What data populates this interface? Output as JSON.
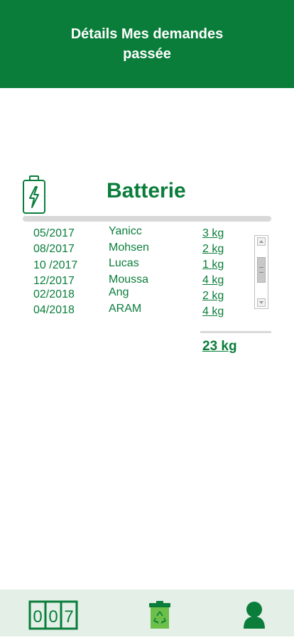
{
  "header": {
    "title": "Détails Mes demandes passée"
  },
  "section": {
    "title": "Batterie",
    "icon": "battery-charging-icon"
  },
  "rows": [
    {
      "date": "05/2017",
      "name": "Yanicc",
      "weight": "3 kg"
    },
    {
      "date": "08/2017",
      "name": "Mohsen",
      "weight": "2 kg"
    },
    {
      "date": "10 /2017",
      "name": "Lucas",
      "weight": "1 kg"
    },
    {
      "date": "12/2017",
      "name": "Moussa",
      "weight": "4 kg"
    },
    {
      "date": "02/2018",
      "name": "Ang",
      "weight": "2 kg"
    },
    {
      "date": "04/2018",
      "name": "ARAM",
      "weight": "4 kg"
    }
  ],
  "total": "23 kg",
  "bottom_nav": {
    "items": [
      {
        "icon": "counter-icon",
        "digits": [
          "0",
          "0",
          "7"
        ]
      },
      {
        "icon": "recycle-bin-icon"
      },
      {
        "icon": "user-icon"
      }
    ]
  },
  "colors": {
    "primary": "#0a7d3b",
    "nav_bg": "#e3efe7",
    "divider": "#d9d9d9",
    "recycle_green": "#6cc04a"
  }
}
